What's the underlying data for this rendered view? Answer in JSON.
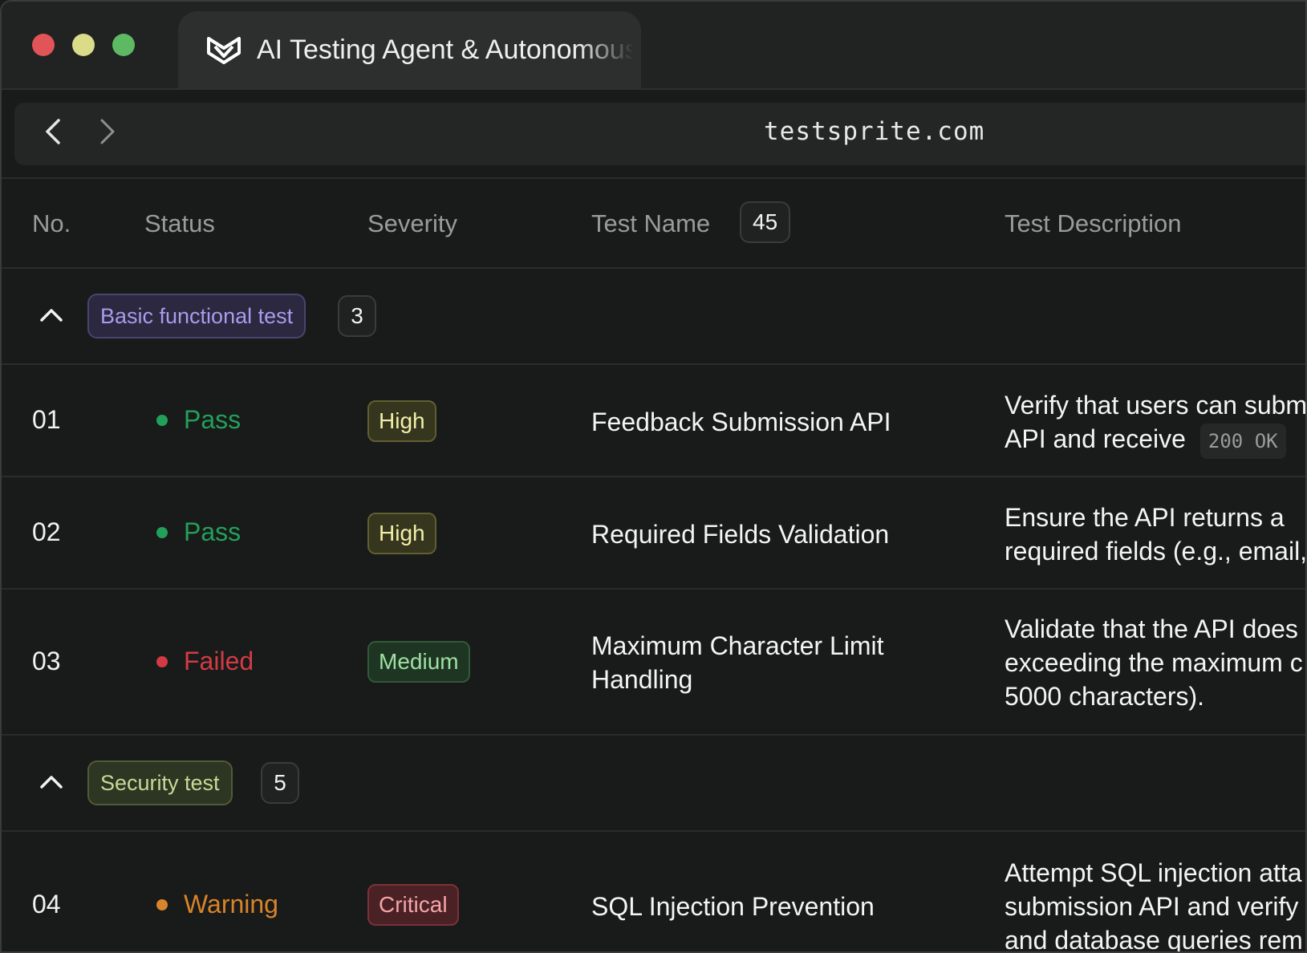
{
  "tab": {
    "title": "AI Testing Agent & Autonomous"
  },
  "address": {
    "url": "testsprite.com"
  },
  "table": {
    "headers": {
      "no": "No.",
      "status": "Status",
      "severity": "Severity",
      "test_name": "Test Name",
      "test_name_count": "45",
      "test_description": "Test Description"
    },
    "groups": [
      {
        "label": "Basic functional test",
        "count": "3"
      },
      {
        "label": "Security test",
        "count": "5"
      }
    ],
    "rows": [
      {
        "no": "01",
        "status": "Pass",
        "severity": "High",
        "name": "Feedback Submission API",
        "desc_line1": "Verify that users can submit",
        "desc_line2": "API and receive",
        "desc_code": "200 OK"
      },
      {
        "no": "02",
        "status": "Pass",
        "severity": "High",
        "name": "Required Fields Validation",
        "desc_line1": "Ensure the API returns a",
        "desc_line2": "required fields (e.g., email,"
      },
      {
        "no": "03",
        "status": "Failed",
        "severity": "Medium",
        "name": "Maximum Character Limit Handling",
        "desc_line1": "Validate that the API does",
        "desc_line2": "exceeding the maximum c",
        "desc_line3": "5000 characters)."
      },
      {
        "no": "04",
        "status": "Warning",
        "severity": "Critical",
        "name": "SQL Injection Prevention",
        "desc_line1": "Attempt SQL injection atta",
        "desc_line2": "submission API and verify",
        "desc_line3": "and database queries rem"
      }
    ]
  },
  "colors": {
    "pass": "#22a05a",
    "failed": "#d23b45",
    "warning": "#d7842a"
  }
}
